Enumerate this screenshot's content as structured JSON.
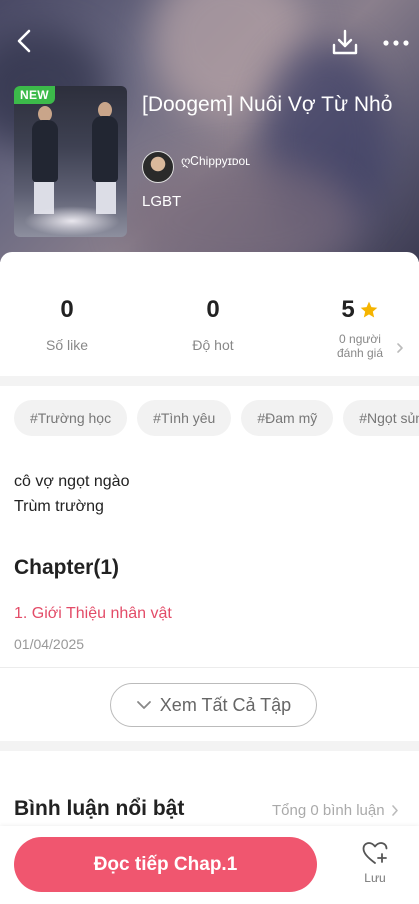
{
  "book": {
    "badge": "NEW",
    "title": "[Doogem] Nuôi Vợ Từ Nhỏ",
    "author": "ღᏟhippyɪᴅᴏʟ",
    "genre": "LGBT"
  },
  "stats": {
    "likes": {
      "value": "0",
      "label": "Số like"
    },
    "hot": {
      "value": "0",
      "label": "Độ hot"
    },
    "rating": {
      "value": "5",
      "label_line1": "0 người",
      "label_line2": "đánh giá"
    }
  },
  "tags": [
    "#Trường học",
    "#Tình yêu",
    "#Đam mỹ",
    "#Ngọt sủng"
  ],
  "description": [
    "cô vợ ngọt ngào",
    "Trùm trường"
  ],
  "chapters": {
    "heading": "Chapter(1)",
    "items": [
      {
        "title": "1. Giới Thiệu nhân vật",
        "date": "01/04/2025"
      }
    ],
    "view_all": "Xem Tất Cả Tập"
  },
  "comments": {
    "heading": "Bình luận nổi bật",
    "total": "Tổng 0 bình luận"
  },
  "actions": {
    "read": "Đọc tiếp Chap.1",
    "save": "Lưu"
  },
  "colors": {
    "accent": "#f0566f",
    "chapter_link": "#e34c68",
    "new_badge": "#3cba4a",
    "star": "#f5b400"
  }
}
